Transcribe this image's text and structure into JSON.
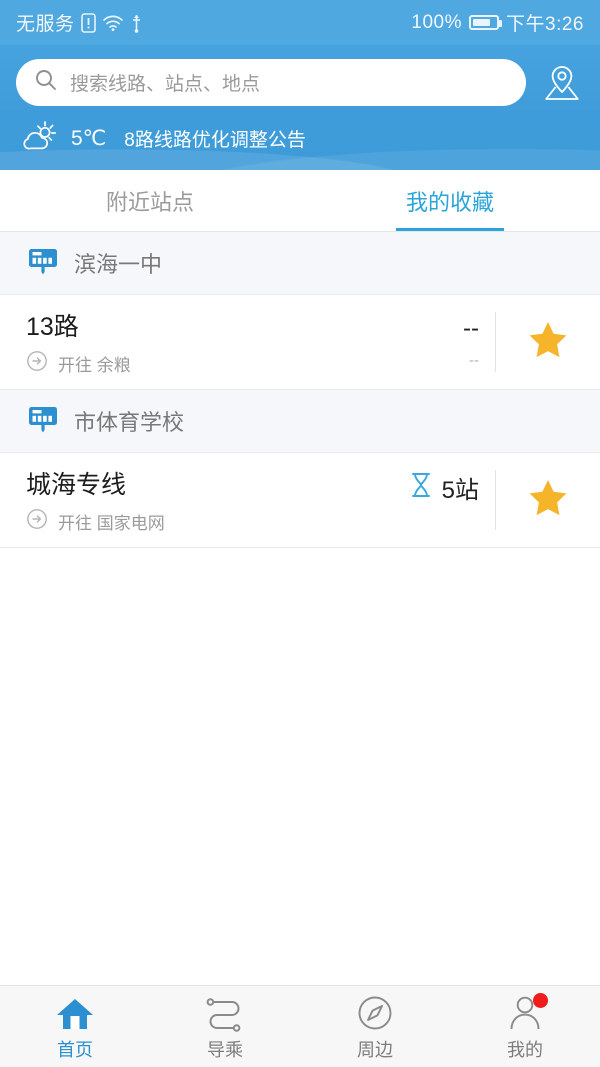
{
  "status_bar": {
    "carrier": "无服务",
    "icons": [
      "sim-alert-icon",
      "wifi-icon",
      "usb-icon"
    ],
    "battery_percent": "100%",
    "time": "下午3:26"
  },
  "header": {
    "search": {
      "placeholder": "搜索线路、站点、地点",
      "icon": "search-icon"
    },
    "map_button_icon": "map-pin-icon",
    "weather": {
      "icon": "partly-cloudy-icon",
      "temperature": "5℃"
    },
    "notice": "8路线路优化调整公告",
    "background_color": "#3f9cda"
  },
  "tabs": {
    "items": [
      {
        "label": "附近站点",
        "active": false
      },
      {
        "label": "我的收藏",
        "active": true
      }
    ],
    "active_color": "#2ba5d9"
  },
  "stations": [
    {
      "icon": "bus-stop-sign-icon",
      "name": "滨海一中",
      "routes": [
        {
          "name": "13路",
          "direction_icon": "arrow-circle-right-icon",
          "direction": "开往 余粮",
          "eta_icon": "",
          "eta_main": "--",
          "eta_sub": "--",
          "favorite": true,
          "favorite_icon": "star-filled-icon"
        }
      ]
    },
    {
      "icon": "bus-stop-sign-icon",
      "name": "市体育学校",
      "routes": [
        {
          "name": "城海专线",
          "direction_icon": "arrow-circle-right-icon",
          "direction": "开往 国家电网",
          "eta_icon": "hourglass-icon",
          "eta_main": "5站",
          "eta_sub": "",
          "favorite": true,
          "favorite_icon": "star-filled-icon"
        }
      ]
    }
  ],
  "bottom_nav": {
    "items": [
      {
        "label": "首页",
        "icon": "home-icon",
        "active": true,
        "badge": false
      },
      {
        "label": "导乘",
        "icon": "route-path-icon",
        "active": false,
        "badge": false
      },
      {
        "label": "周边",
        "icon": "compass-icon",
        "active": false,
        "badge": false
      },
      {
        "label": "我的",
        "icon": "person-icon",
        "active": false,
        "badge": true
      }
    ],
    "active_color": "#2b8fd0",
    "badge_color": "#f01c1c"
  },
  "colors": {
    "star": "#f5b42a",
    "accent": "#2ba5d9",
    "station_header_bg": "#f5f7fa"
  }
}
